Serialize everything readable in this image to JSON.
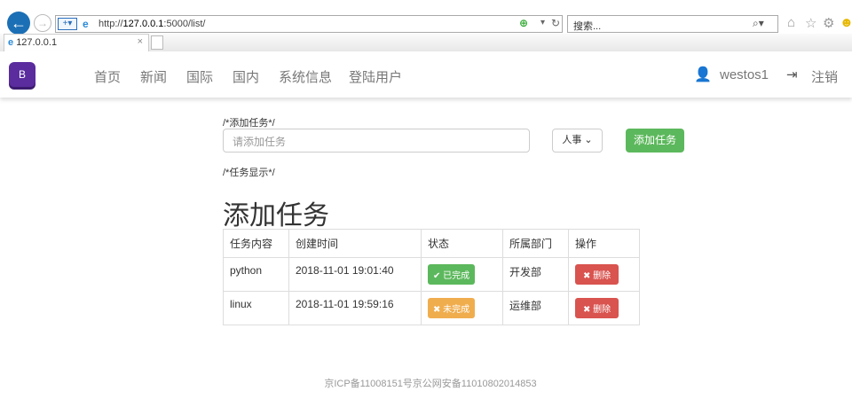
{
  "browser": {
    "url_prefix": "http://",
    "url_host": "127.0.0.1",
    "url_rest": ":5000/list/",
    "search_placeholder": "搜索...",
    "tab_title": "127.0.0.1"
  },
  "navbar": {
    "items": [
      "首页",
      "新闻",
      "国际",
      "国内",
      "系统信息",
      "登陆用户"
    ],
    "username": "westos1",
    "logout": "注销"
  },
  "form": {
    "comment": "/*添加任务*/",
    "placeholder": "请添加任务",
    "department": "人事",
    "add_button": "添加任务"
  },
  "list": {
    "comment": "/*任务显示*/",
    "heading": "添加任务",
    "headers": [
      "任务内容",
      "创建时间",
      "状态",
      "所属部门",
      "操作"
    ],
    "rows": [
      {
        "content": "python",
        "time": "2018-11-01 19:01:40",
        "status": "已完成",
        "dept": "开发部",
        "action": "删除"
      },
      {
        "content": "linux",
        "time": "2018-11-01 19:59:16",
        "status": "未完成",
        "dept": "运维部",
        "action": "删除"
      }
    ]
  },
  "footer": "京ICP备11008151号京公网安备11010802014853"
}
